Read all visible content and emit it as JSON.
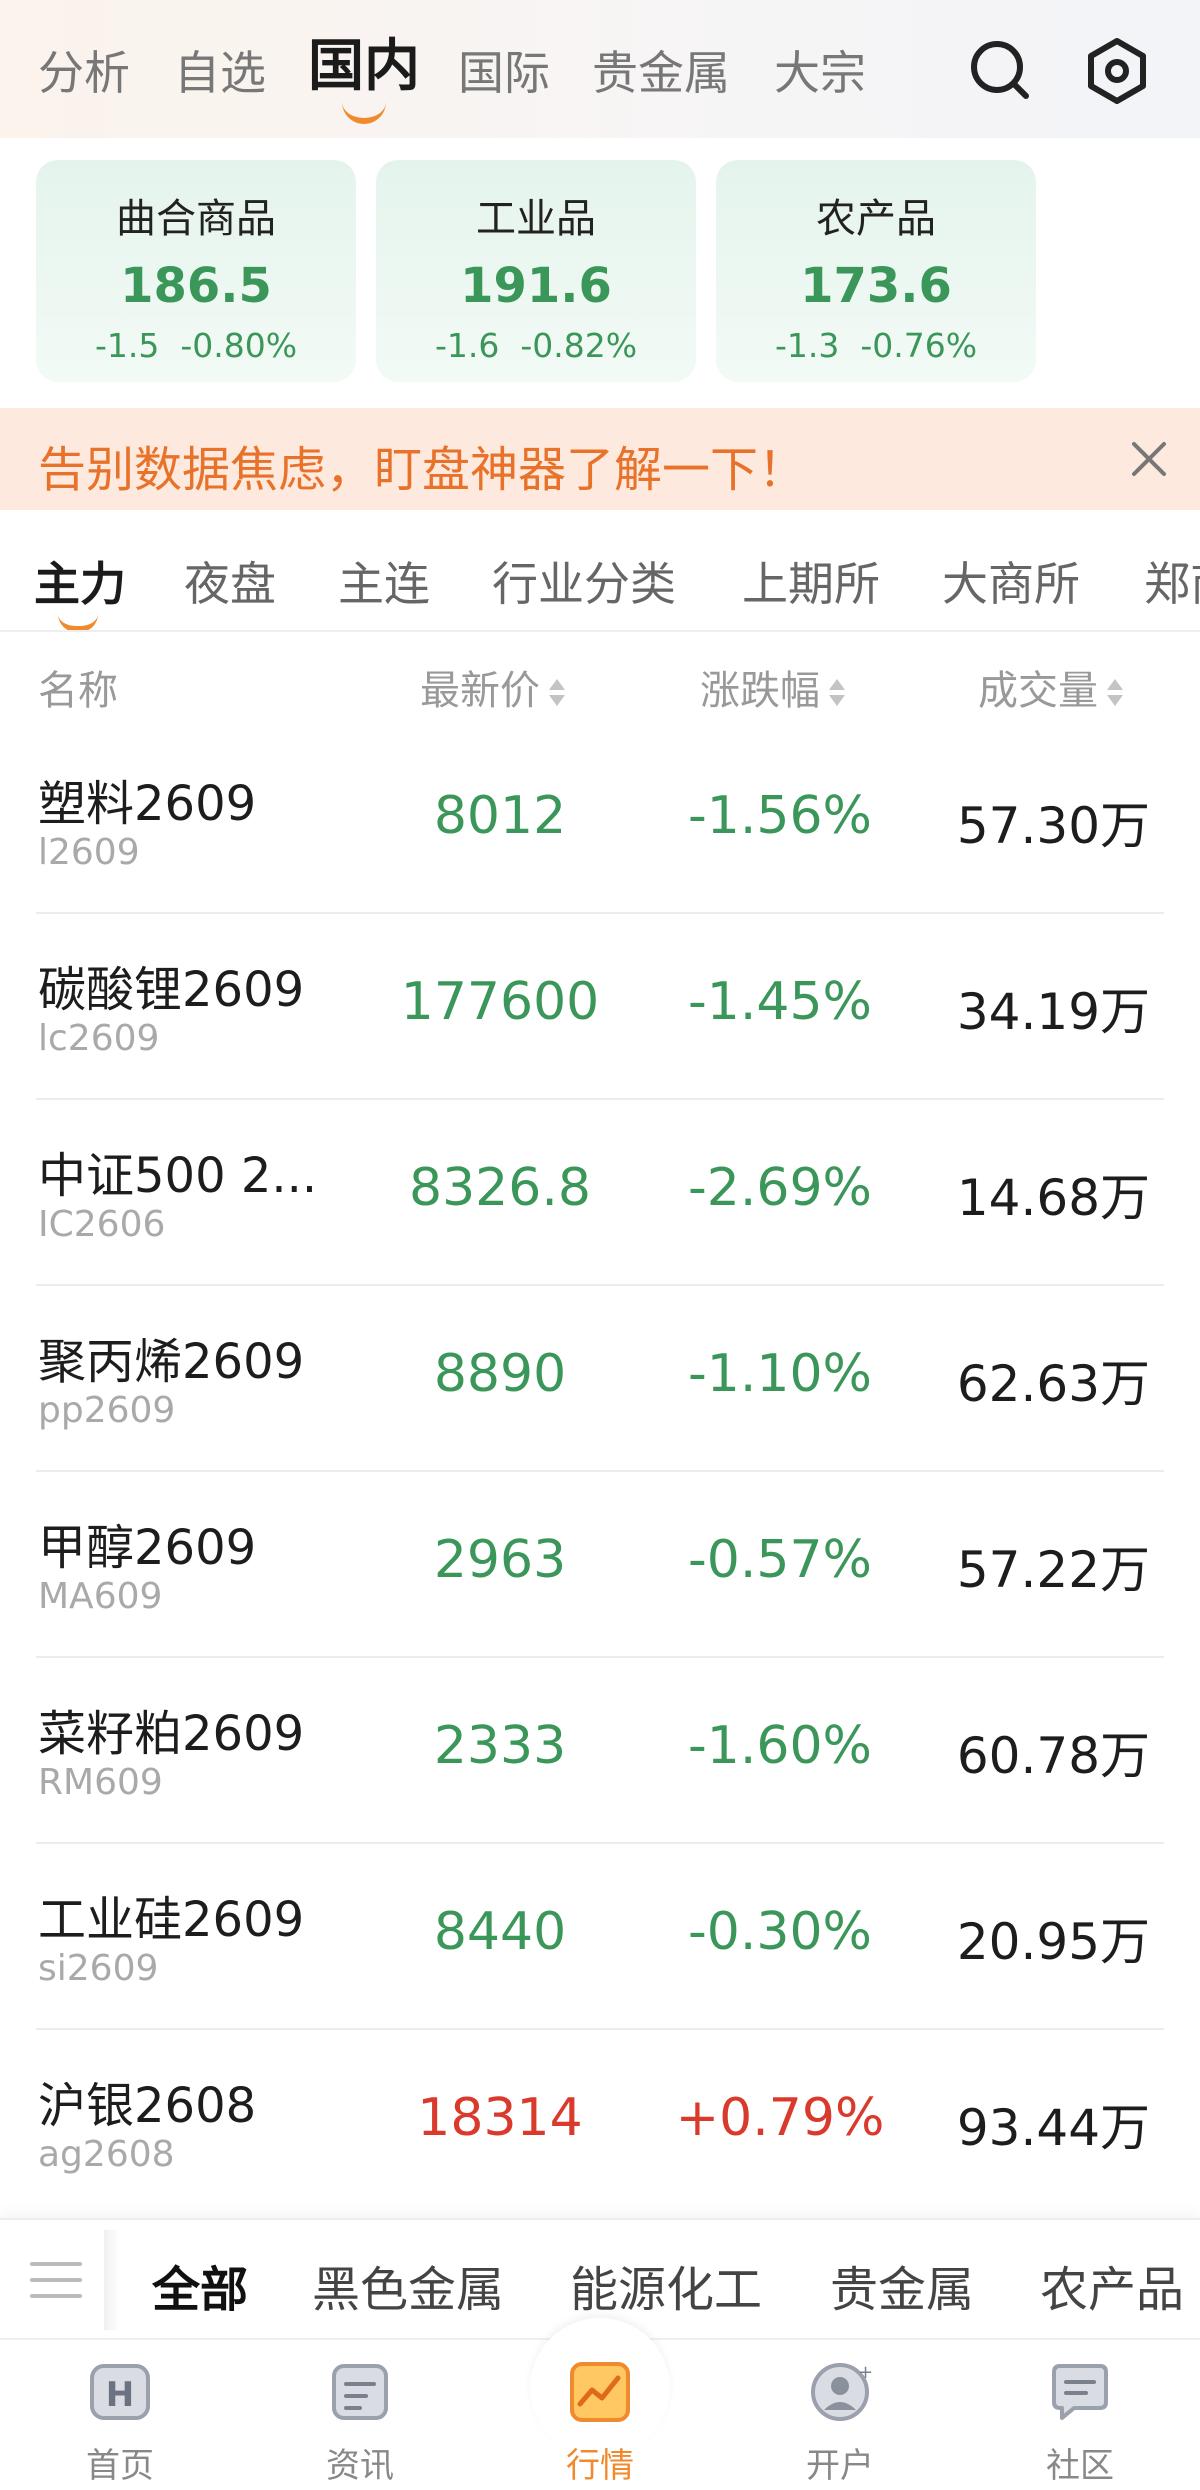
{
  "top_nav": {
    "tabs": [
      "分析",
      "自选",
      "国内",
      "国际",
      "贵金属",
      "大宗"
    ],
    "active": "国内",
    "icons": [
      "search-icon",
      "settings-icon"
    ]
  },
  "index_cards": [
    {
      "name": "曲合商品",
      "value": "186.5",
      "change": "-1.5",
      "percent": "-0.80%"
    },
    {
      "name": "工业品",
      "value": "191.6",
      "change": "-1.6",
      "percent": "-0.82%"
    },
    {
      "name": "农产品",
      "value": "173.6",
      "change": "-1.3",
      "percent": "-0.76%"
    }
  ],
  "banner": {
    "text": "告别数据焦虑，盯盘神器了解一下！",
    "close_icon": "close-icon"
  },
  "category_tabs": [
    "主力",
    "夜盘",
    "主连",
    "行业分类",
    "上期所",
    "大商所",
    "郑商所"
  ],
  "category_active": "主力",
  "table": {
    "headers": {
      "name": "名称",
      "price": "最新价",
      "change": "涨跌幅",
      "volume": "成交量"
    },
    "rows": [
      {
        "name": "塑料2609",
        "code": "l2609",
        "price": "8012",
        "change": "-1.56%",
        "volume": "57.30万",
        "direction": "down"
      },
      {
        "name": "碳酸锂2609",
        "code": "lc2609",
        "price": "177600",
        "change": "-1.45%",
        "volume": "34.19万",
        "direction": "down"
      },
      {
        "name": "中证500 2...",
        "code": "IC2606",
        "price": "8326.8",
        "change": "-2.69%",
        "volume": "14.68万",
        "direction": "down"
      },
      {
        "name": "聚丙烯2609",
        "code": "pp2609",
        "price": "8890",
        "change": "-1.10%",
        "volume": "62.63万",
        "direction": "down"
      },
      {
        "name": "甲醇2609",
        "code": "MA609",
        "price": "2963",
        "change": "-0.57%",
        "volume": "57.22万",
        "direction": "down"
      },
      {
        "name": "菜籽粕2609",
        "code": "RM609",
        "price": "2333",
        "change": "-1.60%",
        "volume": "60.78万",
        "direction": "down"
      },
      {
        "name": "工业硅2609",
        "code": "si2609",
        "price": "8440",
        "change": "-0.30%",
        "volume": "20.95万",
        "direction": "down"
      },
      {
        "name": "沪银2608",
        "code": "ag2608",
        "price": "18314",
        "change": "+0.79%",
        "volume": "93.44万",
        "direction": "up"
      }
    ]
  },
  "bottom_categories": [
    "全部",
    "黑色金属",
    "能源化工",
    "贵金属",
    "农产品"
  ],
  "bottom_category_active": "全部",
  "tab_bar": [
    {
      "label": "首页",
      "icon": "home-icon"
    },
    {
      "label": "资讯",
      "icon": "news-icon"
    },
    {
      "label": "行情",
      "icon": "market-icon"
    },
    {
      "label": "开户",
      "icon": "account-icon"
    },
    {
      "label": "社区",
      "icon": "community-icon"
    }
  ],
  "tab_bar_active": "行情",
  "colors": {
    "accent": "#f08a2c",
    "down": "#3b9659",
    "up": "#d93a2c",
    "banner_bg": "#fde9dd",
    "banner_text": "#e8722a"
  }
}
